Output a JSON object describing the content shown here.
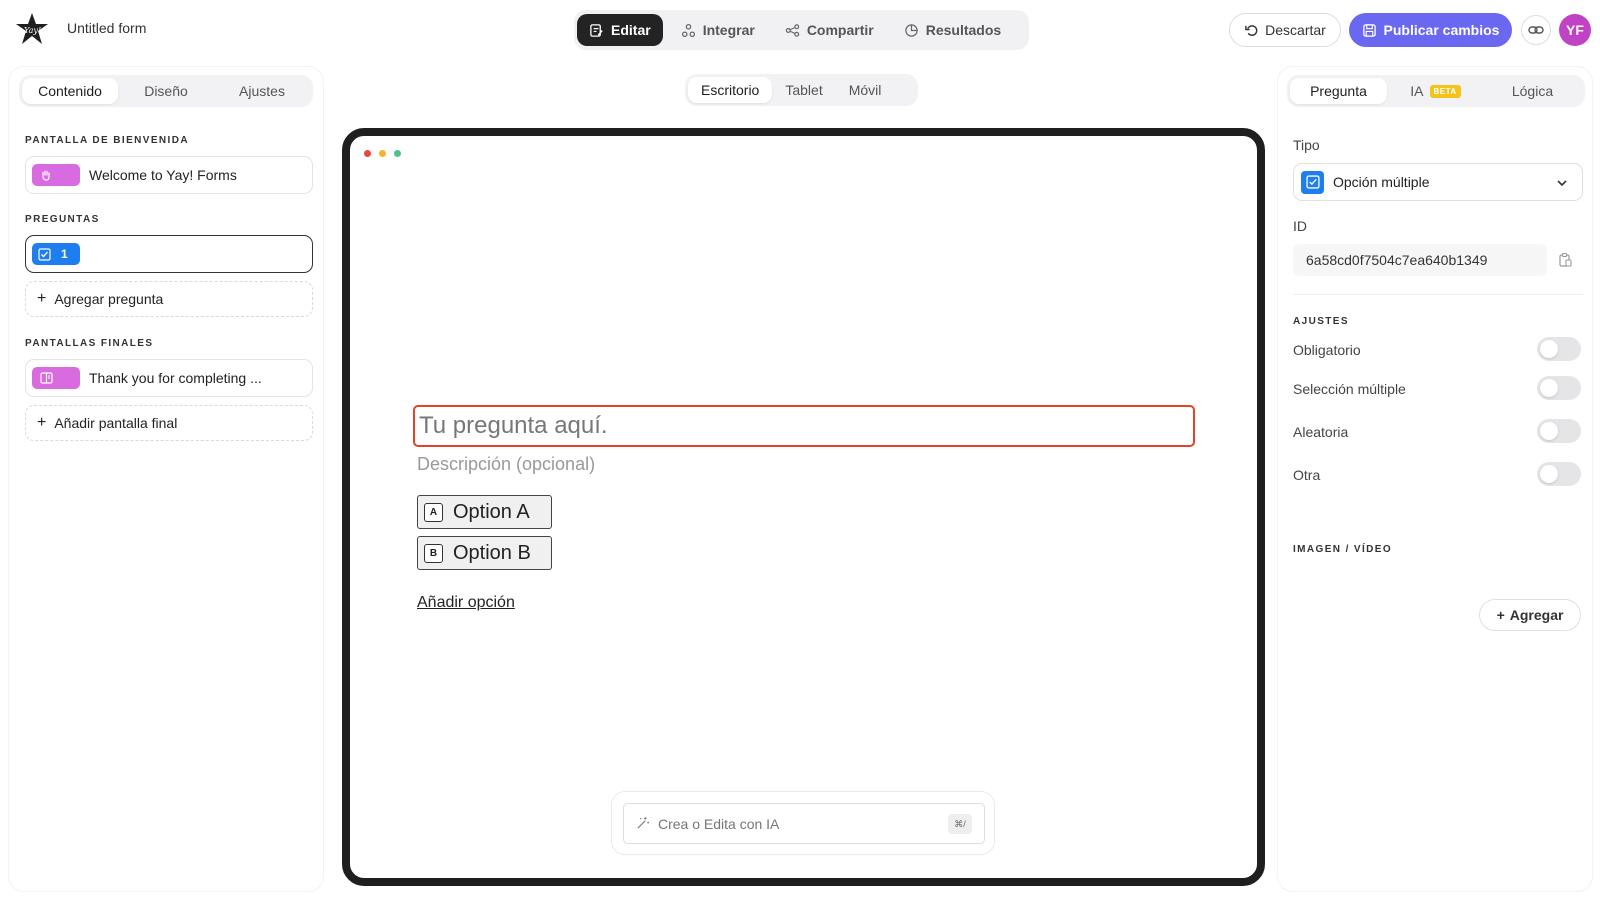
{
  "header": {
    "form_title": "Untitled form",
    "tabs": [
      {
        "label": "Editar",
        "icon": "edit-icon",
        "active": true
      },
      {
        "label": "Integrar",
        "icon": "integrate-icon",
        "active": false
      },
      {
        "label": "Compartir",
        "icon": "share-icon",
        "active": false
      },
      {
        "label": "Resultados",
        "icon": "results-icon",
        "active": false
      }
    ],
    "discard_label": "Descartar",
    "publish_label": "Publicar cambios",
    "avatar_initials": "YF",
    "colors": {
      "publish": "#6a68f0",
      "avatar": "#c042c5",
      "active_tab": "#232323"
    }
  },
  "left": {
    "tabs": [
      "Contenido",
      "Diseño",
      "Ajustes"
    ],
    "active_tab": "Contenido",
    "welcome_section": "PANTALLA DE BIENVENIDA",
    "welcome_item": "Welcome to Yay! Forms",
    "questions_section": "PREGUNTAS",
    "question_number": "1",
    "add_question": "Agregar pregunta",
    "endings_section": "PANTALLAS FINALES",
    "ending_item": "Thank you for completing ...",
    "add_ending": "Añadir pantalla final",
    "colors": {
      "welcome_icon": "#d96be0",
      "question_badge": "#1e7ef0"
    }
  },
  "center": {
    "devices": [
      "Escritorio",
      "Tablet",
      "Móvil"
    ],
    "active_device": "Escritorio",
    "question_placeholder": "Tu pregunta aquí.",
    "description_placeholder": "Descripción (opcional)",
    "options": [
      {
        "key": "A",
        "label": "Option A"
      },
      {
        "key": "B",
        "label": "Option B"
      }
    ],
    "add_option": "Añadir opción",
    "ai_placeholder": "Crea o Edita con IA",
    "ai_shortcut": "⌘/",
    "colors": {
      "highlight": "#e0432f"
    }
  },
  "right": {
    "tabs": [
      "Pregunta",
      "IA",
      "Lógica"
    ],
    "beta_badge": "BETA",
    "active_tab": "Pregunta",
    "type_label": "Tipo",
    "type_value": "Opción múltiple",
    "id_label": "ID",
    "id_value": "6a58cd0f7504c7ea640b1349",
    "settings_section": "AJUSTES",
    "toggles": [
      {
        "label": "Obligatorio",
        "on": false
      },
      {
        "label": "Selección múltiple",
        "on": false
      },
      {
        "label": "Aleatoria",
        "on": false
      },
      {
        "label": "Otra",
        "on": false
      }
    ],
    "media_section": "IMAGEN / VÍDEO",
    "add_media": "Agregar"
  }
}
